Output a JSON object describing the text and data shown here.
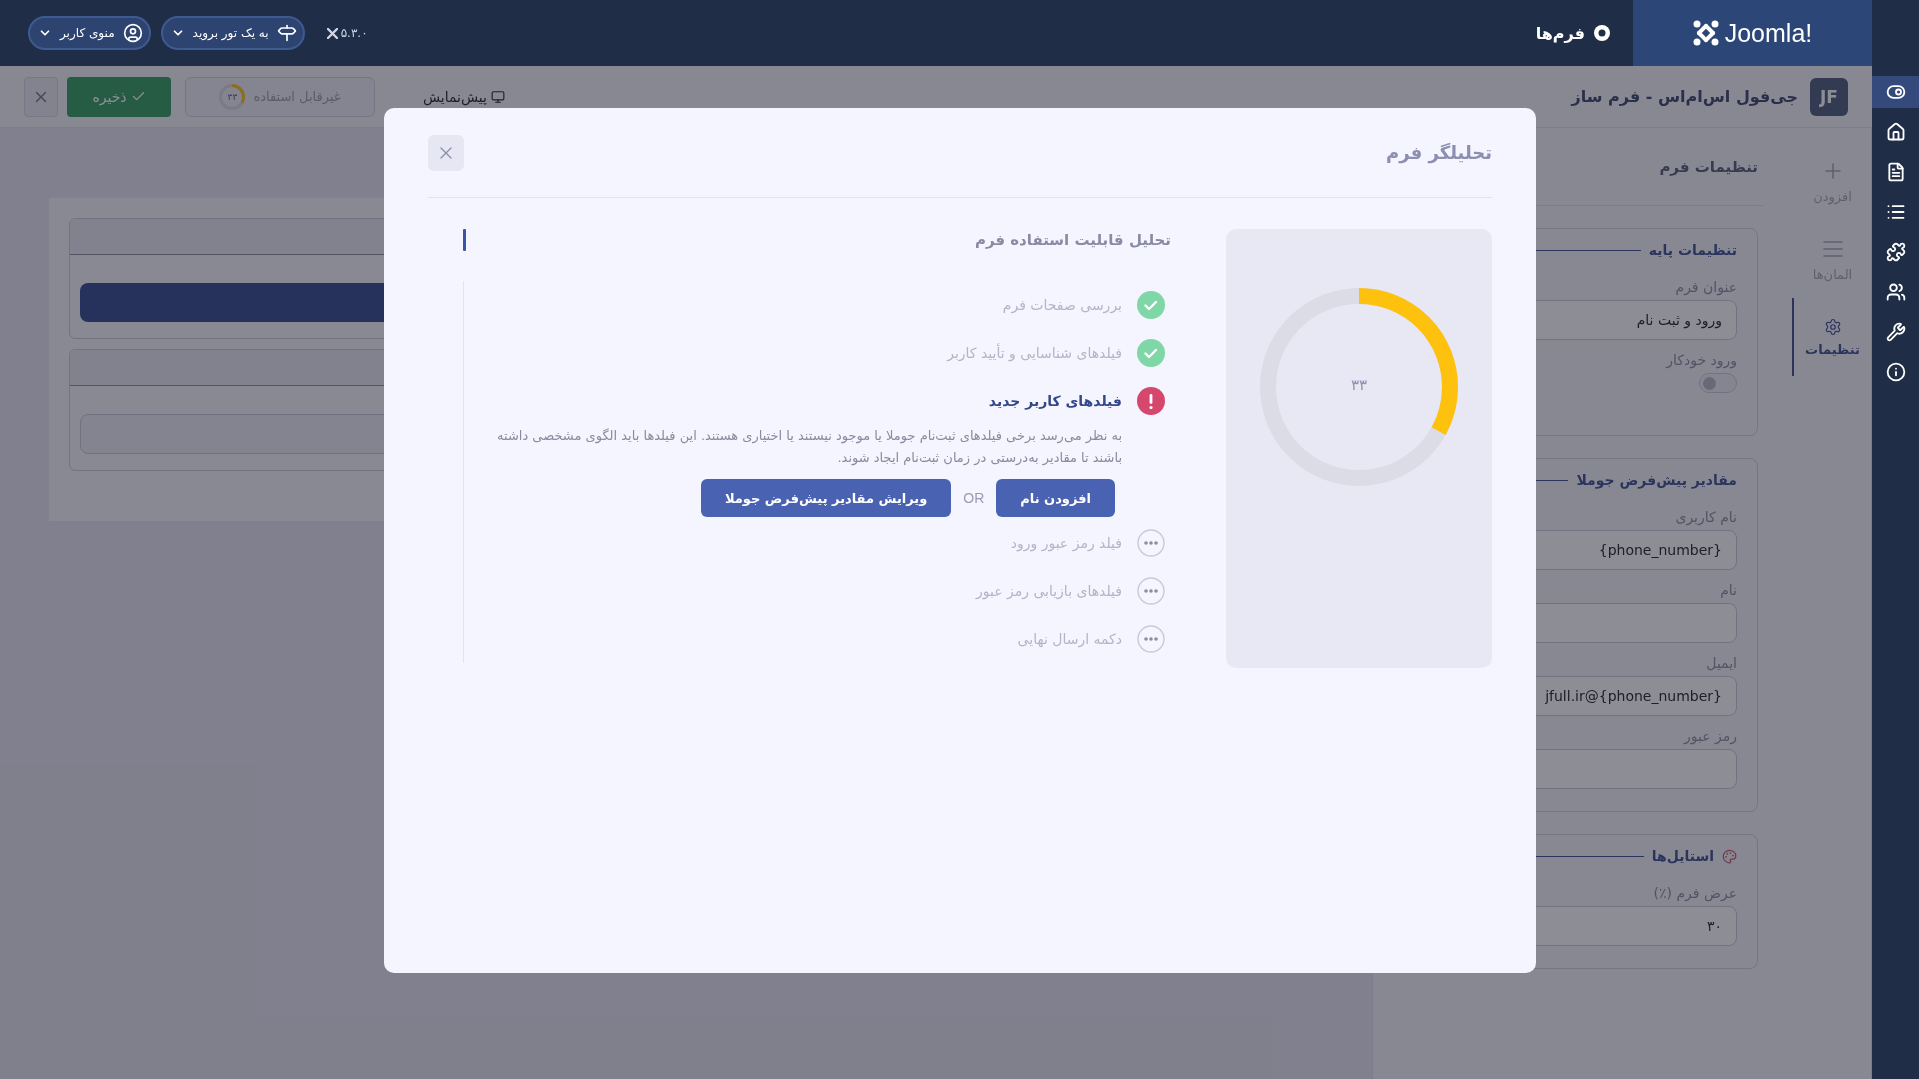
{
  "top_bar": {
    "brand": "Joomla!",
    "section": "فرم‌ها",
    "version": "۵.۳.۰",
    "menus": [
      {
        "label": "به یک تور بروید",
        "kind": "tour"
      },
      {
        "label": "منوی کاربر",
        "kind": "user"
      }
    ]
  },
  "sidebar": {
    "items": [
      {
        "kind": "toggle",
        "selected": true
      },
      {
        "kind": "home",
        "selected": false
      },
      {
        "kind": "file",
        "selected": false
      },
      {
        "kind": "list",
        "selected": false
      },
      {
        "kind": "puzzle",
        "selected": false
      },
      {
        "kind": "users",
        "selected": false
      },
      {
        "kind": "wrench",
        "selected": false
      },
      {
        "kind": "info",
        "selected": false
      }
    ]
  },
  "toolbar": {
    "app_logo": "JF",
    "app_title": "جی‌فول اس‌ام‌اس - فرم ساز",
    "preview": "پیش‌نمایش",
    "usability": {
      "label": "غیرقابل استفاده",
      "score": "۳۳",
      "level": 0.33
    },
    "save": "ذخیره"
  },
  "side_tabs": [
    {
      "label": "افزودن",
      "kind": "add",
      "selected": false
    },
    {
      "label": "المان‌ها",
      "kind": "elements",
      "selected": false
    },
    {
      "label": "تنظیمات",
      "kind": "settings",
      "selected": true
    }
  ],
  "settings_panel": {
    "title": "تنظیمات فرم",
    "groups": [
      {
        "title": "تنظیمات پایه",
        "fields": [
          {
            "label": "عنوان فرم",
            "kind": "text",
            "value": "ورود و ثبت نام"
          },
          {
            "label": "ورود خودکار",
            "kind": "switch",
            "on": false
          }
        ]
      },
      {
        "title": "مقادیر پیش‌فرض جوملا",
        "fields": [
          {
            "label": "نام کاربری",
            "kind": "text",
            "value": "{phone_number}"
          },
          {
            "label": "نام",
            "kind": "text"
          },
          {
            "label": "ایمیل",
            "kind": "text",
            "value": "jfull.ir@{phone_number}"
          },
          {
            "label": "رمز عبور",
            "kind": "text"
          }
        ]
      },
      {
        "title": "استایل‌ها",
        "has_icon": true,
        "fields": [
          {
            "label": "عرض فرم (٪)",
            "kind": "text",
            "value": "۳۰"
          }
        ]
      }
    ]
  },
  "dialog": {
    "title": "تحلیلگر فرم",
    "score": {
      "value": "۳۳",
      "level": 0.33
    },
    "analysis": {
      "title": "تحلیل قابلیت استفاده فرم",
      "checks": [
        {
          "title": "بررسی صفحات فرم",
          "kind": "passed"
        },
        {
          "title": "فیلدهای شناسایی و تأیید کاربر",
          "kind": "passed"
        },
        {
          "title": "فیلدهای کاربر جدید",
          "kind": "failed",
          "description": "به نظر می‌رسد برخی فیلدهای ثبت‌نام جوملا یا موجود نیستند یا اختیاری هستند. این فیلدها باید الگوی مشخصی داشته باشند تا مقادیر به‌درستی در زمان ثبت‌نام ایجاد شوند.",
          "actions": [
            "افزودن نام",
            "ویرایش مقادیر پیش‌فرض جوملا"
          ],
          "separator": "OR"
        },
        {
          "title": "فیلد رمز عبور ورود",
          "kind": "pending"
        },
        {
          "title": "فیلدهای بازیابی رمز عبور",
          "kind": "pending"
        },
        {
          "title": "دکمه ارسال نهایی",
          "kind": "pending"
        }
      ]
    }
  }
}
